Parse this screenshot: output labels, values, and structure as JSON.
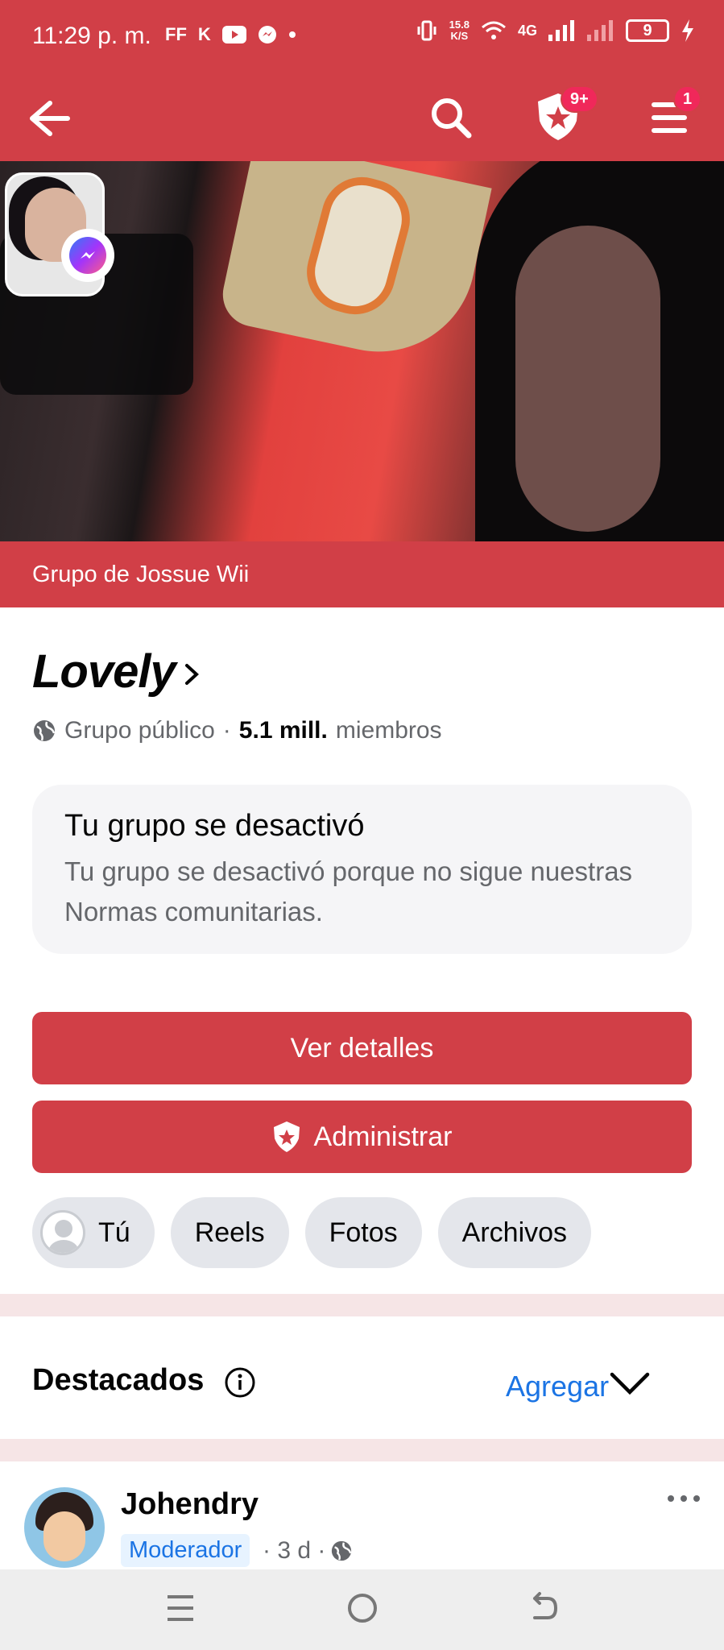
{
  "status_bar": {
    "time": "11:29 p. m.",
    "apps": [
      "FF",
      "K"
    ],
    "speed_value": "15.8",
    "speed_unit": "K/S",
    "network": "4G",
    "battery": "9"
  },
  "app_bar": {
    "notifications_badge": "9+",
    "menu_badge": "1"
  },
  "cover": {
    "owner_label": "Grupo de Jossue Wii"
  },
  "group": {
    "name": "Lovely",
    "privacy": "Grupo público",
    "separator": "·",
    "members_count": "5.1 mill.",
    "members_label": "miembros"
  },
  "notice": {
    "title": "Tu grupo se desactivó",
    "body": "Tu grupo se desactivó porque no sigue nuestras Normas comunitarias."
  },
  "actions": {
    "details_label": "Ver detalles",
    "manage_label": "Administrar"
  },
  "chips": [
    "Tú",
    "Reels",
    "Fotos",
    "Archivos"
  ],
  "featured": {
    "title": "Destacados",
    "add_label": "Agregar"
  },
  "post": {
    "author": "Johendry",
    "role": "Moderador",
    "time": "· 3 d ·"
  },
  "colors": {
    "brand_red": "#d13f47",
    "link_blue": "#1b74e4",
    "badge_pink": "#f0285a"
  },
  "icons": [
    "back-arrow-icon",
    "search-icon",
    "shield-star-icon",
    "menu-icon",
    "messenger-icon",
    "globe-icon",
    "chevron-right-icon",
    "info-icon",
    "chevron-down-icon",
    "more-icon",
    "recent-apps-icon",
    "home-icon",
    "back-nav-icon"
  ]
}
